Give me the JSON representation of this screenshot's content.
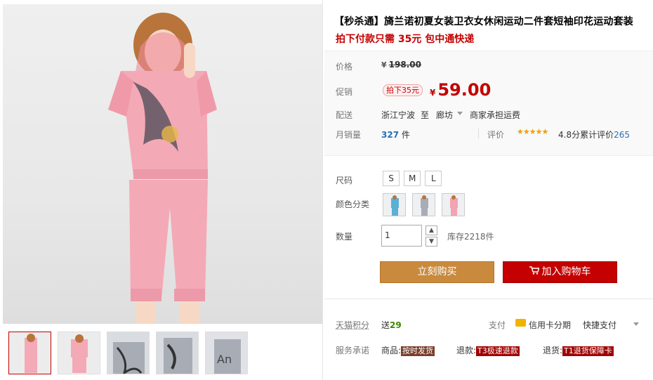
{
  "product": {
    "title": "【秒杀通】旖兰诺初夏女装卫衣女休闲运动二件套短袖印花运动套装",
    "subtitle": "拍下付款只需 35元 包中通快递"
  },
  "price": {
    "label": "价格",
    "currency": "¥",
    "original": "198.00"
  },
  "promo": {
    "label": "促销",
    "tag": "拍下35元",
    "currency": "¥",
    "price": "59.00"
  },
  "shipping": {
    "label": "配送",
    "from": "浙江宁波",
    "to_word": "至",
    "destination": "廊坊",
    "fee_note": "商家承担运费"
  },
  "sales": {
    "label": "月销量",
    "count": "327",
    "unit": "件",
    "review_label": "评价",
    "stars": "★★★★★",
    "score": "4.8分",
    "total_label": "累计评价",
    "total": "265"
  },
  "size": {
    "label": "尺码",
    "options": [
      "S",
      "M",
      "L"
    ]
  },
  "color": {
    "label": "颜色分类",
    "swatches": [
      {
        "name": "blue-outfit",
        "color": "#5ab0d6"
      },
      {
        "name": "gray-outfit",
        "color": "#a8adb5"
      },
      {
        "name": "pink-outfit",
        "color": "#f2a3b4"
      }
    ]
  },
  "quantity": {
    "label": "数量",
    "value": "1",
    "up": "▲",
    "down": "▼",
    "stock": "库存2218件"
  },
  "actions": {
    "buy_now": "立刻购买",
    "add_to_cart": "加入购物车",
    "cart_icon": "cart-icon"
  },
  "points": {
    "label": "天猫积分",
    "prefix": "送",
    "value": "29"
  },
  "payment": {
    "label": "支付",
    "installment": "信用卡分期",
    "quick": "快捷支付"
  },
  "service": {
    "label": "服务承诺",
    "goods_label": "商品:",
    "goods_badge": "按时发货",
    "refund_label": "退款:",
    "refund_badge": "T3极速退款",
    "return_label": "退货:",
    "return_badge": "T1退货保障卡"
  },
  "colors": {
    "accent_red": "#c40000",
    "buy_orange": "#c98a3e",
    "outfit_pink": "#f4a9b6"
  }
}
